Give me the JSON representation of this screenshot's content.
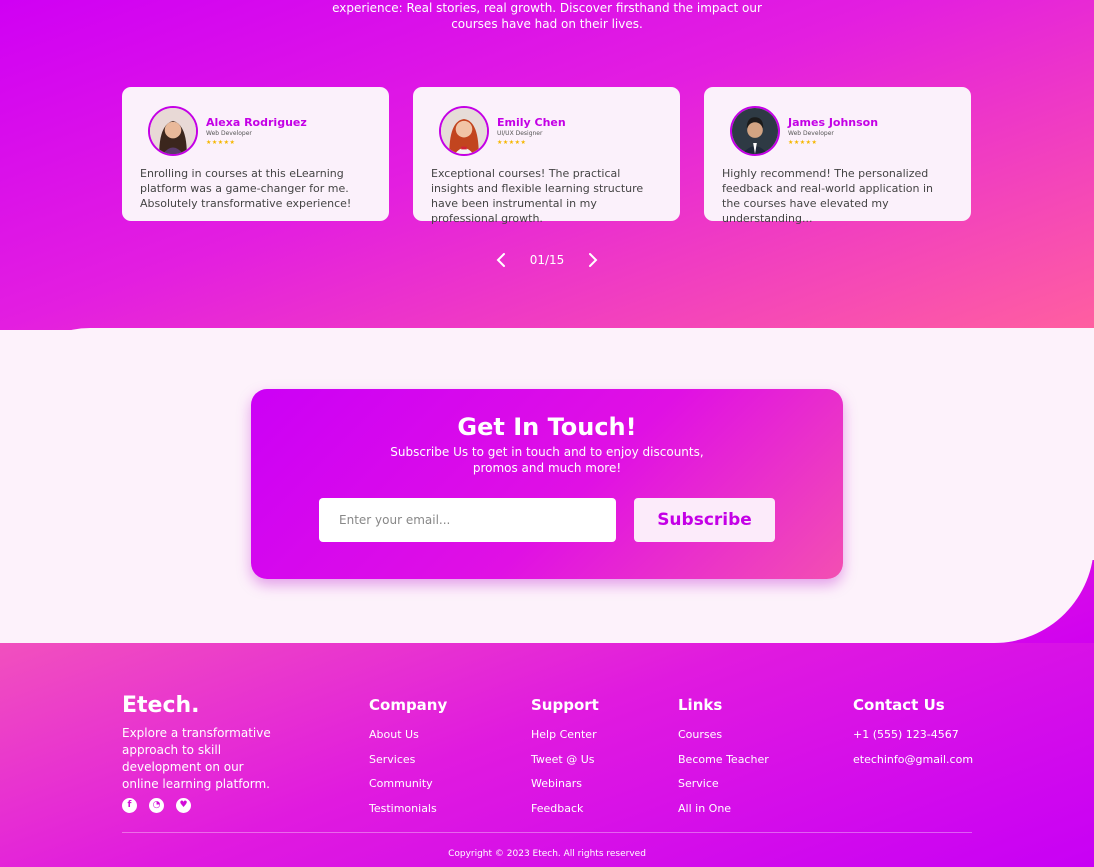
{
  "intro": {
    "line1": "experience: Real stories, real growth. Discover firsthand the impact our",
    "line2": "courses have had on their lives."
  },
  "testimonials": [
    {
      "name": "Alexa Rodriguez",
      "role": "Web Developer",
      "stars": "★★★★★",
      "quote": "Enrolling in courses at this eLearning platform was a game-changer for me. Absolutely transformative experience!"
    },
    {
      "name": "Emily Chen",
      "role": "UI/UX Designer",
      "stars": "★★★★★",
      "quote": "Exceptional courses! The practical insights and flexible learning structure have been instrumental in my professional growth."
    },
    {
      "name": "James Johnson",
      "role": "Web Developer",
      "stars": "★★★★★",
      "quote": "Highly recommend! The personalized feedback and real-world application in the courses have elevated my understanding..."
    }
  ],
  "pager": {
    "count": "01/15"
  },
  "touch": {
    "title": "Get In Touch!",
    "sub_line1": "Subscribe Us to get in touch and to enjoy discounts,",
    "sub_line2": "promos and much more!",
    "email_placeholder": "Enter your email...",
    "email_value": "",
    "subscribe_label": "Subscribe"
  },
  "footer": {
    "brand": "Etech.",
    "description": "Explore a transformative approach to skill development on our online learning platform.",
    "socials": [
      "facebook-icon",
      "whatsapp-icon",
      "twitter-icon"
    ],
    "company": {
      "title": "Company",
      "items": [
        "About Us",
        "Services",
        "Community",
        "Testimonials"
      ]
    },
    "support": {
      "title": "Support",
      "items": [
        "Help Center",
        "Tweet @ Us",
        "Webinars",
        "Feedback"
      ]
    },
    "links": {
      "title": "Links",
      "items": [
        "Courses",
        "Become Teacher",
        "Service",
        "All in One"
      ]
    },
    "contact": {
      "title": "Contact Us",
      "items": [
        "+1 (555) 123-4567",
        "etechinfo@gmail.com"
      ]
    },
    "copyright": "Copyright © 2023 Etech. All rights reserved"
  },
  "colors": {
    "accent": "#c400e6",
    "gradient_start": "#d000f4",
    "gradient_end": "#ff5fa0",
    "star": "#f5b700"
  }
}
